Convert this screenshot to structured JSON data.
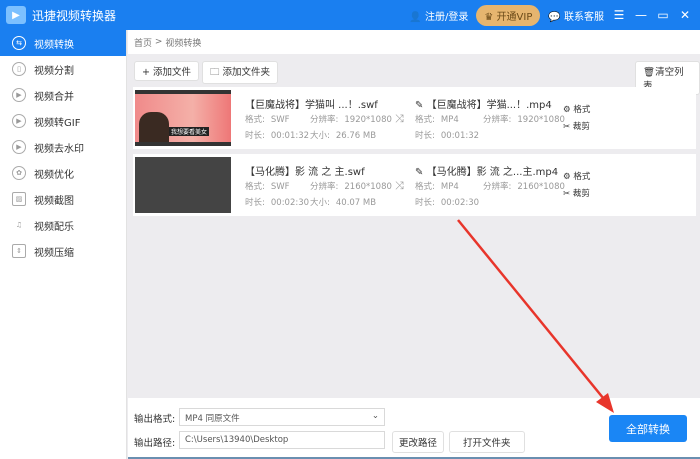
{
  "app": {
    "title": "迅捷视频转换器",
    "login": "注册/登录",
    "vip": "开通VIP",
    "support": "联系客服"
  },
  "sidebar": {
    "items": [
      {
        "label": "视频转换"
      },
      {
        "label": "视频分割"
      },
      {
        "label": "视频合并"
      },
      {
        "label": "视频转GIF"
      },
      {
        "label": "视频去水印"
      },
      {
        "label": "视频优化"
      },
      {
        "label": "视频截图"
      },
      {
        "label": "视频配乐"
      },
      {
        "label": "视频压缩"
      }
    ]
  },
  "breadcrumb": {
    "home": "首页",
    "sep": ">",
    "current": "视频转换"
  },
  "toolbar": {
    "add_file": "+ 添加文件",
    "add_folder": "添加文件夹",
    "clear": "清空列表"
  },
  "files": [
    {
      "src_name": "【巨魔战将】学猫叫 ...！.swf",
      "src_format": "SWF",
      "src_res": "1920*1080",
      "src_dur": "00:01:32",
      "src_size": "26.76 MB",
      "out_name": "【巨魔战将】学猫...！.mp4",
      "out_format": "MP4",
      "out_res": "1920*1080",
      "out_dur": "00:01:32",
      "thumb_caption": "我想要看美女"
    },
    {
      "src_name": "【马化腾】影 流 之 主.swf",
      "src_format": "SWF",
      "src_res": "2160*1080",
      "src_dur": "00:02:30",
      "src_size": "40.07 MB",
      "out_name": "【马化腾】影 流 之...主.mp4",
      "out_format": "MP4",
      "out_res": "2160*1080",
      "out_dur": "00:02:30"
    }
  ],
  "labels": {
    "format": "格式:",
    "resolution": "分辨率:",
    "duration": "时长:",
    "size": "大小:",
    "format_op": "格式",
    "cut_op": "裁剪"
  },
  "output": {
    "format_label": "输出格式:",
    "format_value": "MP4  同原文件",
    "path_label": "输出路径:",
    "path_value": "C:\\Users\\13940\\Desktop",
    "change_path": "更改路径",
    "open_folder": "打开文件夹",
    "convert_all": "全部转换"
  },
  "colors": {
    "accent": "#1a7ff0",
    "vip": "#e6b56f",
    "arrow": "#e8352b"
  }
}
